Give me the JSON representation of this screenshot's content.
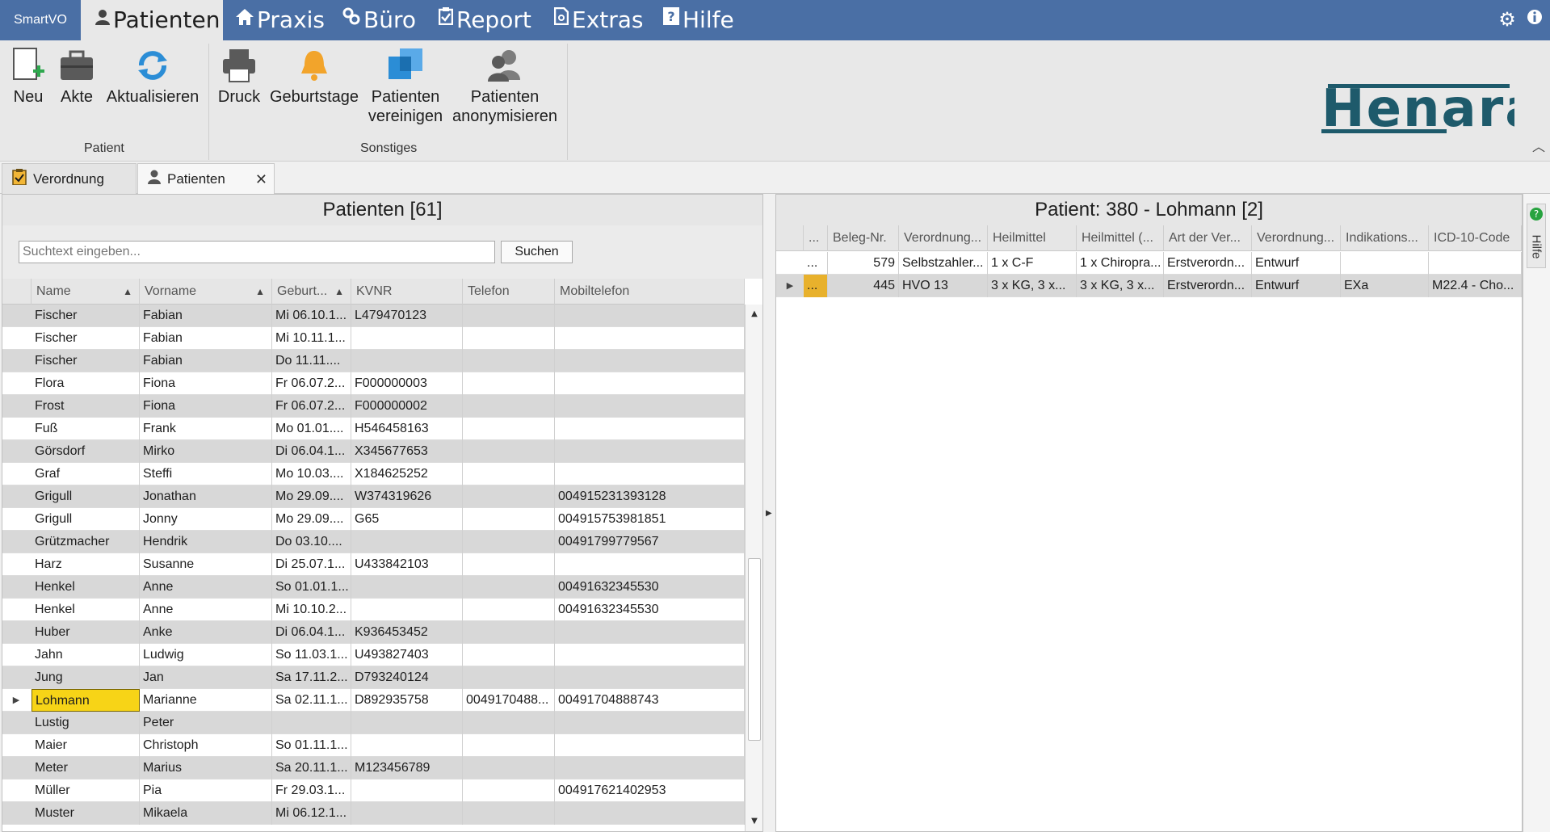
{
  "app": {
    "name": "SmartVO"
  },
  "menu": [
    {
      "label": "Patienten",
      "icon": "person-icon"
    },
    {
      "label": "Praxis",
      "icon": "home-icon"
    },
    {
      "label": "Büro",
      "icon": "link-icon"
    },
    {
      "label": "Report",
      "icon": "clipboard-icon"
    },
    {
      "label": "Extras",
      "icon": "document-icon"
    },
    {
      "label": "Hilfe",
      "icon": "question-icon"
    }
  ],
  "ribbon": {
    "groups": [
      {
        "label": "Patient",
        "buttons": [
          "Neu",
          "Akte",
          "Aktualisieren"
        ]
      },
      {
        "label": "Sonstiges",
        "buttons": [
          "Druck",
          "Geburtstage",
          "Patienten vereinigen",
          "Patienten anonymisieren"
        ]
      }
    ],
    "buttons": {
      "neu": "Neu",
      "akte": "Akte",
      "aktualisieren": "Aktualisieren",
      "druck": "Druck",
      "geburtstage": "Geburtstage",
      "vereinigen_1": "Patienten",
      "vereinigen_2": "vereinigen",
      "anonym_1": "Patienten",
      "anonym_2": "anonymisieren"
    },
    "group_patient": "Patient",
    "group_sonstiges": "Sonstiges",
    "logo_text": "Henara"
  },
  "tabs": {
    "verordnung": "Verordnung",
    "patienten": "Patienten"
  },
  "left": {
    "title": "Patienten [61]",
    "search_placeholder": "Suchtext eingeben...",
    "search_button": "Suchen",
    "columns": [
      "Name",
      "Vorname",
      "Geburt...",
      "KVNR",
      "Telefon",
      "Mobiltelefon"
    ],
    "rows": [
      [
        "Fischer",
        "Fabian",
        "Mi 06.10.1...",
        "L479470123",
        "",
        ""
      ],
      [
        "Fischer",
        "Fabian",
        "Mi 10.11.1...",
        "",
        "",
        ""
      ],
      [
        "Fischer",
        "Fabian",
        "Do 11.11....",
        "",
        "",
        ""
      ],
      [
        "Flora",
        "Fiona",
        "Fr 06.07.2...",
        "F000000003",
        "",
        ""
      ],
      [
        "Frost",
        "Fiona",
        "Fr 06.07.2...",
        "F000000002",
        "",
        ""
      ],
      [
        "Fuß",
        "Frank",
        "Mo 01.01....",
        "H546458163",
        "",
        ""
      ],
      [
        "Görsdorf",
        "Mirko",
        "Di 06.04.1...",
        "X345677653",
        "",
        ""
      ],
      [
        "Graf",
        "Steffi",
        "Mo 10.03....",
        "X184625252",
        "",
        ""
      ],
      [
        "Grigull",
        "Jonathan",
        "Mo 29.09....",
        "W374319626",
        "",
        "004915231393128"
      ],
      [
        "Grigull",
        "Jonny",
        "Mo 29.09....",
        "G65",
        "",
        "004915753981851"
      ],
      [
        "Grützmacher",
        "Hendrik",
        "Do 03.10....",
        "",
        "",
        "00491799779567"
      ],
      [
        "Harz",
        "Susanne",
        "Di 25.07.1...",
        "U433842103",
        "",
        ""
      ],
      [
        "Henkel",
        "Anne",
        "So 01.01.1...",
        "",
        "",
        "00491632345530"
      ],
      [
        "Henkel",
        "Anne",
        "Mi 10.10.2...",
        "",
        "",
        "00491632345530"
      ],
      [
        "Huber",
        "Anke",
        "Di 06.04.1...",
        "K936453452",
        "",
        ""
      ],
      [
        "Jahn",
        "Ludwig",
        "So 11.03.1...",
        "U493827403",
        "",
        ""
      ],
      [
        "Jung",
        "Jan",
        "Sa 17.11.2...",
        "D793240124",
        "",
        ""
      ],
      [
        "Lohmann",
        "Marianne",
        "Sa 02.11.1...",
        "D892935758",
        "0049170488...",
        "00491704888743"
      ],
      [
        "Lustig",
        "Peter",
        "",
        "",
        "",
        ""
      ],
      [
        "Maier",
        "Christoph",
        "So 01.11.1...",
        "",
        "",
        ""
      ],
      [
        "Meter",
        "Marius",
        "Sa 20.11.1...",
        "M123456789",
        "",
        ""
      ],
      [
        "Müller",
        "Pia",
        "Fr 29.03.1...",
        "",
        "",
        "004917621402953"
      ],
      [
        "Muster",
        "Mikaela",
        "Mi 06.12.1...",
        "",
        "",
        ""
      ]
    ],
    "selected_row": 17
  },
  "right": {
    "title": "Patient: 380 - Lohmann [2]",
    "columns": [
      "...",
      "Beleg-Nr.",
      "Verordnung...",
      "Heilmittel",
      "Heilmittel (...",
      "Art der Ver...",
      "Verordnung...",
      "Indikations...",
      "ICD-10-Code"
    ],
    "rows": [
      [
        "...",
        "579",
        "Selbstzahler...",
        "1 x C-F",
        "1 x Chiropra...",
        "Erstverordn...",
        "Entwurf",
        "",
        ""
      ],
      [
        "...",
        "445",
        "HVO 13",
        "3 x KG, 3 x...",
        "3 x KG, 3 x...",
        "Erstverordn...",
        "Entwurf",
        "EXa",
        "M22.4 - Cho..."
      ]
    ]
  },
  "side_panel": {
    "label": "Hilfe"
  }
}
